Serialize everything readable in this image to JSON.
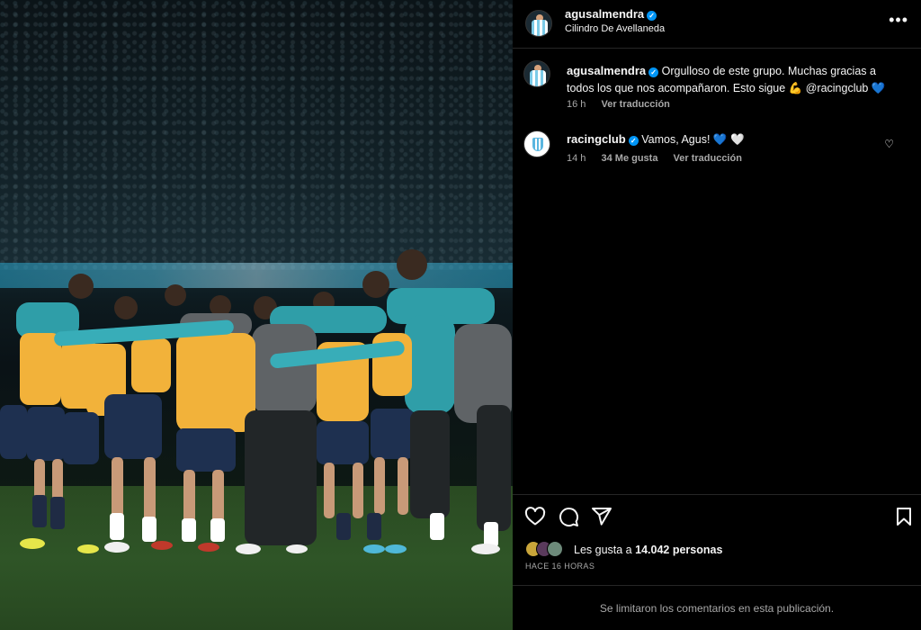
{
  "post": {
    "author": "agusalmendra",
    "location": "Cilindro De Avellaneda",
    "caption": "Orgulloso de este grupo. Muchas gracias a todos los que nos acompañaron. Esto sigue 💪 @racingclub 💙",
    "caption_time": "16 h",
    "caption_translate": "Ver traducción",
    "likes_prefix": "Les gusta a",
    "likes_count": "14.042 personas",
    "time_ago": "HACE 16 HORAS",
    "comments_limited": "Se limitaron los comentarios en esta publicación."
  },
  "comments": [
    {
      "author": "racingclub",
      "text": "Vamos, Agus! 💙 🤍",
      "time": "14 h",
      "likes": "34 Me gusta",
      "translate": "Ver traducción"
    }
  ],
  "icons": {
    "more": "more-options-icon",
    "like": "heart-icon",
    "comment": "comment-icon",
    "share": "send-icon",
    "save": "bookmark-icon",
    "verified": "verified-badge-icon"
  },
  "colors": {
    "background": "#000000",
    "text": "#f5f5f5",
    "secondary_text": "#a8a8a8",
    "divider": "#262626",
    "verified": "#0095f6",
    "racing_blue": "#5ab6e0",
    "jersey_yellow": "#f4b33c"
  }
}
